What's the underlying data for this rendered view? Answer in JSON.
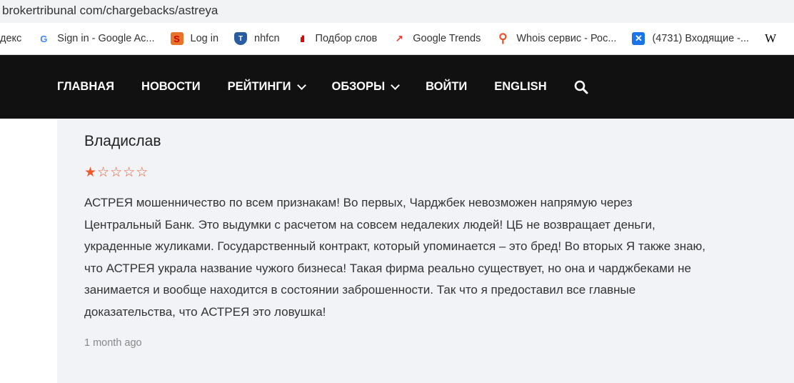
{
  "browser": {
    "url": "brokertribunal com/chargebacks/astreya",
    "bookmarks": [
      {
        "label": "декс",
        "icon": "yandex-icon"
      },
      {
        "label": "Sign in - Google Ac...",
        "icon": "google-icon"
      },
      {
        "label": "Log in",
        "icon": "login-icon"
      },
      {
        "label": "nhfcn",
        "icon": "shield-icon"
      },
      {
        "label": "Подбор слов",
        "icon": "bars-icon"
      },
      {
        "label": "Google Trends",
        "icon": "trends-icon"
      },
      {
        "label": "Whois сервис - Рос...",
        "icon": "search-icon"
      },
      {
        "label": "(4731) Входящие -...",
        "icon": "mail-icon"
      },
      {
        "label": "W",
        "icon": "wiki-icon"
      }
    ]
  },
  "nav": {
    "items": [
      "ГЛАВНАЯ",
      "НОВОСТИ",
      "РЕЙТИНГИ",
      "ОБЗОРЫ",
      "ВОЙТИ",
      "ENGLISH"
    ]
  },
  "review": {
    "author": "Владислав",
    "rating": 1,
    "max_rating": 5,
    "lines": [
      "АСТРЕЯ мошенничество по всем признакам! Во первых, Чарджбек невозможен напрямую через",
      "Центральный Банк. Это выдумки с расчетом на совсем недалеких людей! ЦБ не возвращает деньги,",
      "украденные жуликами. Государственный контракт, который упоминается – это бред! Во вторых Я также знаю,",
      "что АСТРЕЯ украла название чужого бизнеса! Такая фирма реально существует, но она и чарджбеками не",
      "занимается и вообще находится в состоянии заброшенности. Так что я предоставил все главные",
      "доказательства, что АСТРЕЯ это ловушка!"
    ],
    "time": "1 month ago"
  }
}
